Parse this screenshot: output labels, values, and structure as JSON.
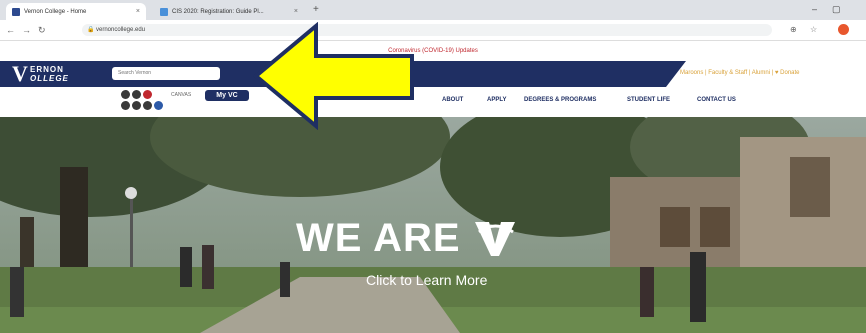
{
  "browser": {
    "tabs": [
      {
        "title": "Vernon College - Home"
      },
      {
        "title": "CIS 2020: Registration: Guide Pl..."
      }
    ],
    "new_tab": "+",
    "url": "vernoncollege.edu",
    "window_controls": [
      "–",
      "▢"
    ]
  },
  "site": {
    "alert": "Coronavirus (COVID-19) Updates",
    "logo": {
      "line1": "ERNON",
      "line2": "OLLEGE"
    },
    "search_placeholder": "Search Vernon",
    "top_links": "Maroons | Faculty & Staff | Alumni | ♥ Donate",
    "canvas_label": "CANVAS",
    "myvc_label": "My VC",
    "nav": [
      "ABOUT",
      "APPLY",
      "DEGREES & PROGRAMS",
      "STUDENT LIFE",
      "CONTACT US"
    ],
    "hero": {
      "title": "WE ARE",
      "cta": "Click to Learn More"
    }
  },
  "colors": {
    "navy": "#1f2f63",
    "gold": "#d9a23a",
    "red": "#c0282f",
    "arrow_fill": "#ffff00",
    "arrow_stroke": "#1f2f63"
  }
}
